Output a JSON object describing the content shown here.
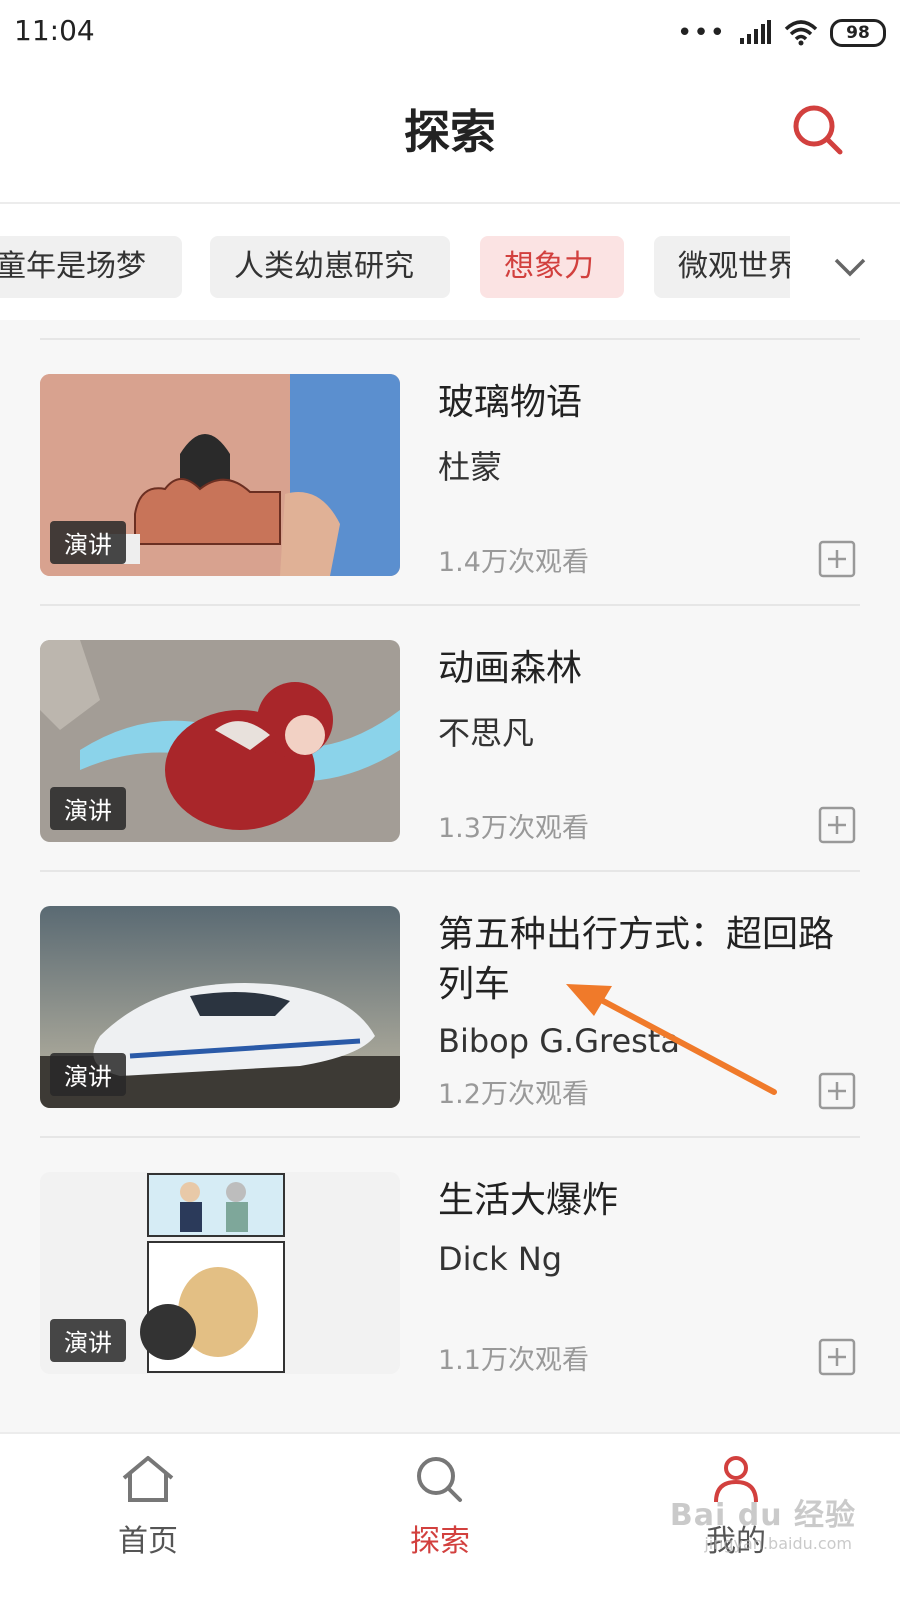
{
  "status_bar": {
    "time": "11:04",
    "signal_dots": "•••",
    "battery": "98"
  },
  "header": {
    "title": "探索"
  },
  "categories": [
    {
      "label": "童年是场梦",
      "active": false
    },
    {
      "label": "人类幼崽研究",
      "active": false
    },
    {
      "label": "想象力",
      "active": true
    },
    {
      "label": "微观世界",
      "active": false
    }
  ],
  "items": [
    {
      "title": "玻璃物语",
      "author": "杜蒙",
      "views": "1.4万次观看",
      "badge": "演讲"
    },
    {
      "title": "动画森林",
      "author": "不思凡",
      "views": "1.3万次观看",
      "badge": "演讲"
    },
    {
      "title": "第五种出行方式：超回路列车",
      "author": "Bibop G.Gresta",
      "views": "1.2万次观看",
      "badge": "演讲"
    },
    {
      "title": "生活大爆炸",
      "author": "Dick Ng",
      "views": "1.1万次观看",
      "badge": "演讲"
    }
  ],
  "nav": {
    "home": "首页",
    "explore": "探索",
    "mine": "我的"
  },
  "watermark": {
    "brand": "Bai du 经验",
    "url": "jingyan.baidu.com"
  },
  "colors": {
    "accent": "#d2403e",
    "arrow": "#f07a2a",
    "chip_active_bg": "#fbe3e3"
  },
  "icons": [
    "search-icon",
    "chevron-down-icon",
    "plus-box-icon",
    "home-icon",
    "search-nav-icon",
    "user-icon",
    "wifi-icon",
    "signal-icon",
    "arrow-annotation"
  ]
}
